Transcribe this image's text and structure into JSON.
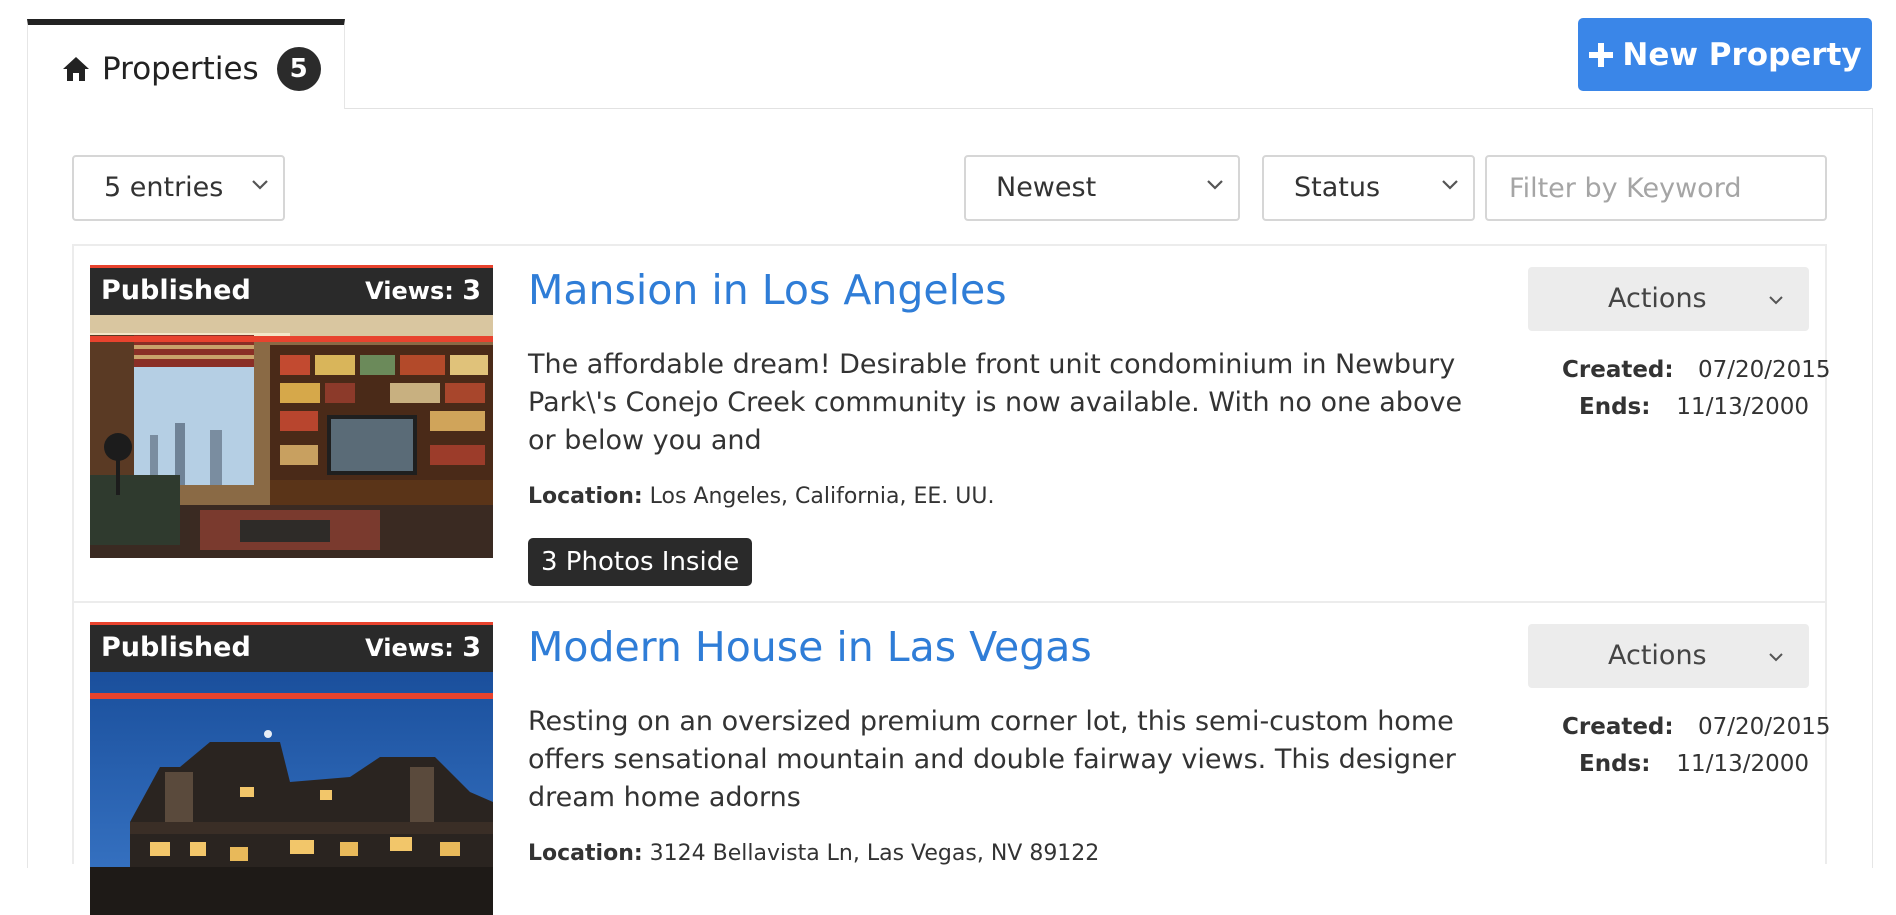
{
  "tab": {
    "label": "Properties",
    "count": "5"
  },
  "new_button": {
    "label": "New Property"
  },
  "filters": {
    "entries": "5 entries",
    "sort": "Newest",
    "status": "Status",
    "keyword_placeholder": "Filter by Keyword"
  },
  "properties": [
    {
      "status": "Published",
      "views_label": "Views:",
      "views": "3",
      "title": "Mansion in Los Angeles",
      "description": "The affordable dream! Desirable front unit condominium in Newbury Park\\'s Conejo Creek community is now available. With no one above or below you and",
      "location_label": "Location:",
      "location": "Los Angeles, California, EE. UU.",
      "photos": "3 Photos Inside",
      "actions": "Actions",
      "created_label": "Created:",
      "created": "07/20/2015",
      "ends_label": "Ends:",
      "ends": "11/13/2000"
    },
    {
      "status": "Published",
      "views_label": "Views:",
      "views": "3",
      "title": "Modern House in Las Vegas",
      "description": "Resting on an oversized premium corner lot, this semi-custom home offers sensational mountain and double fairway views. This designer dream home adorns",
      "location_label": "Location:",
      "location": "3124 Bellavista Ln, Las Vegas, NV 89122",
      "actions": "Actions",
      "created_label": "Created:",
      "created": "07/20/2015",
      "ends_label": "Ends:",
      "ends": "11/13/2000"
    }
  ],
  "colors": {
    "accent": "#3a86e8",
    "link": "#2f7dd7",
    "highlight": "#e8432e",
    "dark": "#2a2a2a"
  }
}
